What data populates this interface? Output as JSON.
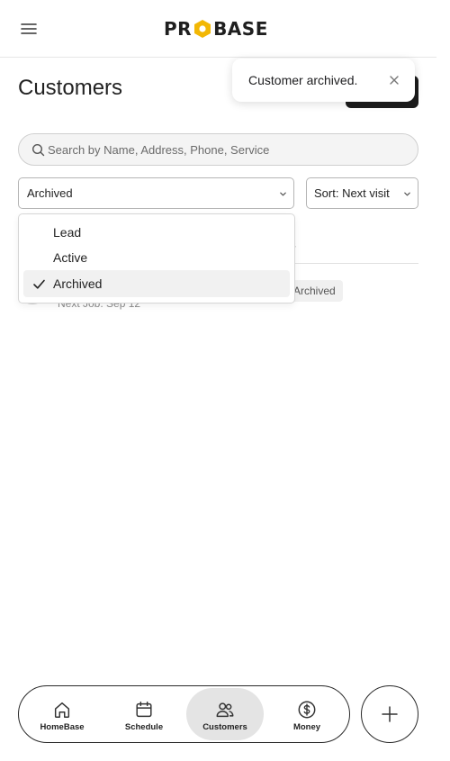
{
  "app": {
    "logo_text_left": "PR",
    "logo_text_right": "BASE",
    "brand_color": "#f2b705"
  },
  "header": {
    "menu_icon": "hamburger-menu-icon"
  },
  "page": {
    "title": "Customers"
  },
  "toast": {
    "message": "Customer archived.",
    "close_icon": "close-icon"
  },
  "search": {
    "placeholder": "Search by Name, Address, Phone, Service",
    "value": ""
  },
  "filters": {
    "status_selected": "Archived",
    "sort_label": "Sort: Next visit",
    "status_options": [
      {
        "label": "Lead",
        "selected": false
      },
      {
        "label": "Active",
        "selected": false
      },
      {
        "label": "Archived",
        "selected": true
      }
    ]
  },
  "table": {
    "header_status_partial": "us",
    "rows": [
      {
        "next_job": "Next Job: Sep 12",
        "status": "Archived"
      }
    ]
  },
  "nav": {
    "items": [
      {
        "label": "HomeBase",
        "icon": "home-icon",
        "active": false
      },
      {
        "label": "Schedule",
        "icon": "calendar-icon",
        "active": false
      },
      {
        "label": "Customers",
        "icon": "users-icon",
        "active": true
      },
      {
        "label": "Money",
        "icon": "dollar-icon",
        "active": false
      }
    ],
    "fab_icon": "plus-icon"
  }
}
